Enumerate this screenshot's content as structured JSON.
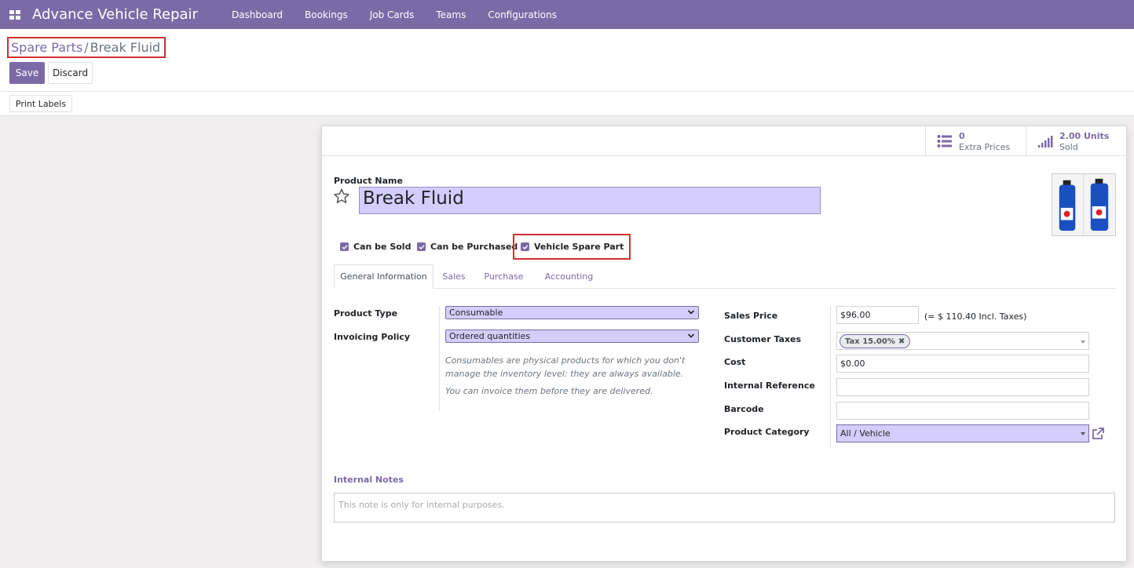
{
  "navbar": {
    "app_title": "Advance Vehicle Repair",
    "menu": [
      "Dashboard",
      "Bookings",
      "Job Cards",
      "Teams",
      "Configurations"
    ]
  },
  "breadcrumb": {
    "parent": "Spare Parts",
    "separator": "/",
    "current": "Break Fluid"
  },
  "buttons": {
    "save": "Save",
    "discard": "Discard",
    "print_labels": "Print Labels"
  },
  "stat_buttons": [
    {
      "value": "0",
      "label": "Extra Prices",
      "icon": "list-icon"
    },
    {
      "value": "2.00 Units",
      "label": "Sold",
      "icon": "signal-bars-icon"
    }
  ],
  "product": {
    "name_label": "Product Name",
    "name": "Break Fluid"
  },
  "options": [
    {
      "label": "Can be Sold",
      "checked": true
    },
    {
      "label": "Can be Purchased",
      "checked": true
    },
    {
      "label": "Vehicle Spare Part",
      "checked": true
    }
  ],
  "tabs": [
    "General Information",
    "Sales",
    "Purchase",
    "Accounting"
  ],
  "general": {
    "product_type_label": "Product Type",
    "product_type": "Consumable",
    "invoicing_policy_label": "Invoicing Policy",
    "invoicing_policy": "Ordered quantities",
    "help_line1": "Consumables are physical products for which you don't manage the inventory level: they are always available.",
    "help_line2": "You can invoice them before they are delivered.",
    "sales_price_label": "Sales Price",
    "sales_price": "$96.00",
    "sales_price_incl": "(= $ 110.40 Incl. Taxes)",
    "customer_taxes_label": "Customer Taxes",
    "customer_tax_tag": "Tax 15.00%",
    "cost_label": "Cost",
    "cost": "$0.00",
    "internal_reference_label": "Internal Reference",
    "internal_reference": "",
    "barcode_label": "Barcode",
    "barcode": "",
    "product_category_label": "Product Category",
    "product_category": "All / Vehicle"
  },
  "notes": {
    "label": "Internal Notes",
    "placeholder": "This note is only for internal purposes."
  },
  "colors": {
    "brand": "#7c6aa7",
    "required_field": "#d5cdfb",
    "highlight_box": "#d32f2f"
  }
}
